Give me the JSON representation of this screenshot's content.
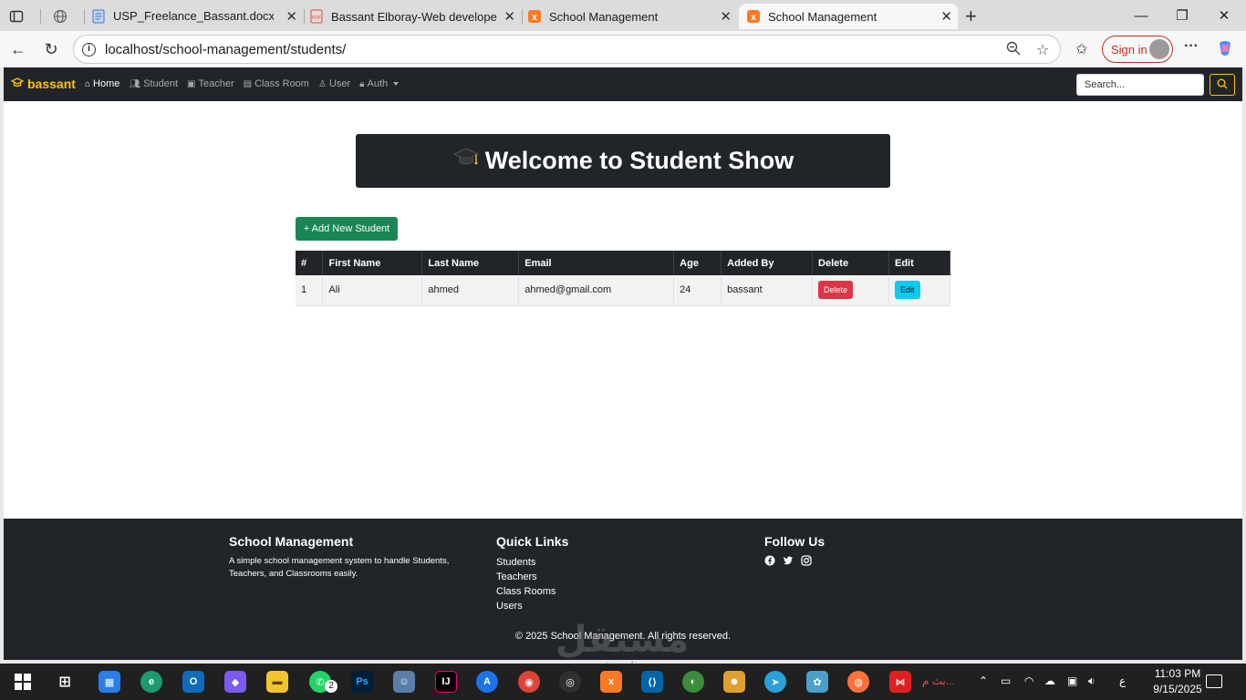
{
  "browser": {
    "tabs": [
      {
        "label": "",
        "icon": "globe-icon"
      },
      {
        "label": "USP_Freelance_Bassant.docx - ت...",
        "icon": "word-doc-icon"
      },
      {
        "label": "Bassant Elboray-Web developer.p",
        "icon": "pdf-icon"
      },
      {
        "label": "School Management",
        "icon": "xampp-icon"
      },
      {
        "label": "School Management",
        "icon": "xampp-icon",
        "active": true
      }
    ],
    "url": "localhost/school-management/students/",
    "sign_in_label": "Sign in",
    "colors": {
      "tab_strip": "#dcdcdc",
      "signin": "#c42b1c"
    }
  },
  "app": {
    "brand": "bassant",
    "nav": [
      {
        "label": "Home",
        "icon": "house-icon",
        "active": true
      },
      {
        "label": "Student",
        "icon": "people-icon"
      },
      {
        "label": "Teacher",
        "icon": "person-badge-icon"
      },
      {
        "label": "Class Room",
        "icon": "building-icon"
      },
      {
        "label": "User",
        "icon": "person-icon"
      },
      {
        "label": "Auth",
        "icon": "lock-icon",
        "dropdown": true
      }
    ],
    "search_placeholder": "Search...",
    "hero_title": "Welcome to Student Show",
    "add_button": "+ Add New Student",
    "table": {
      "headers": [
        "#",
        "First Name",
        "Last Name",
        "Email",
        "Age",
        "Added By",
        "Delete",
        "Edit"
      ],
      "rows": [
        {
          "id": "1",
          "first_name": "Ali",
          "last_name": "ahmed",
          "email": "ahmed@gmail.com",
          "age": "24",
          "added_by": "bassant",
          "delete_label": "Delete",
          "edit_label": "Edit"
        }
      ]
    },
    "footer": {
      "about_title": "School Management",
      "about_text": "A simple school management system to handle Students, Teachers, and Classrooms easily.",
      "links_title": "Quick Links",
      "links": [
        "Students",
        "Teachers",
        "Class Rooms",
        "Users"
      ],
      "follow_title": "Follow Us",
      "social": [
        "facebook-icon",
        "twitter-icon",
        "instagram-icon"
      ],
      "copyright": "© 2025 School Management. All rights reserved."
    },
    "colors": {
      "dark": "#212529",
      "brand": "#ffc107",
      "success": "#198754",
      "danger": "#dc3545",
      "info": "#0dcaf0"
    }
  },
  "watermark": {
    "line1": "مستقل",
    "line2": "mostaql.com"
  },
  "taskbar": {
    "whatsapp_badge": "2",
    "tray_text": "بث م...",
    "lang": "ع",
    "time": "11:03 PM",
    "date": "9/15/2025"
  }
}
